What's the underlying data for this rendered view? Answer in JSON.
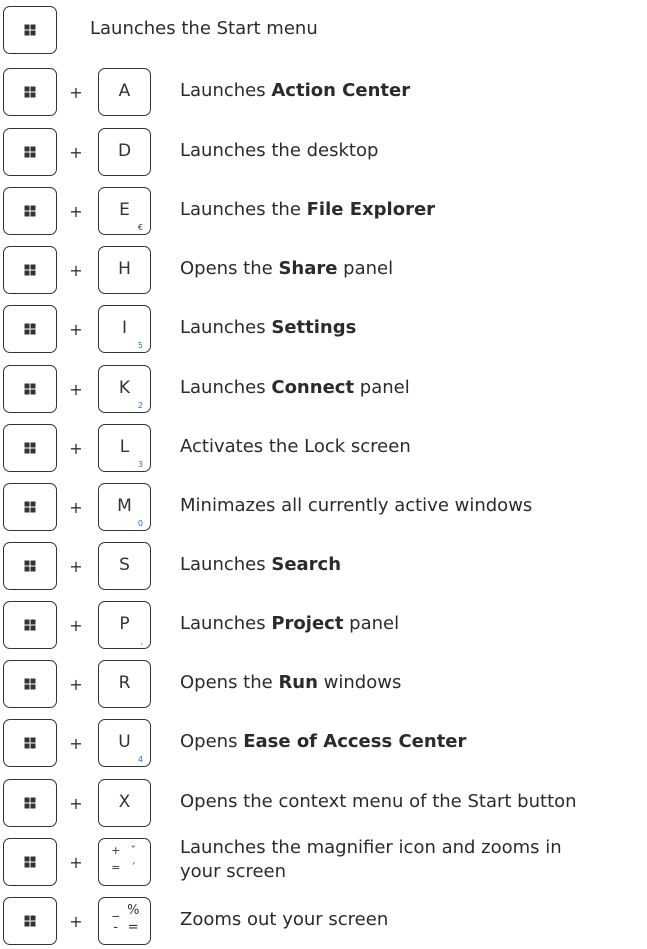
{
  "rows": [
    {
      "key": "",
      "sub": "",
      "pre": "Launches the Start menu",
      "bold": "",
      "post": ""
    },
    {
      "key": "A",
      "sub": "",
      "pre": "Launches ",
      "bold": "Action Center",
      "post": ""
    },
    {
      "key": "D",
      "sub": "",
      "pre": "Launches the desktop",
      "bold": "",
      "post": ""
    },
    {
      "key": "E",
      "sub": "€",
      "pre": "Launches the ",
      "bold": "File Explorer",
      "post": ""
    },
    {
      "key": "H",
      "sub": "",
      "pre": "Opens the ",
      "bold": "Share",
      "post": " panel"
    },
    {
      "key": "I",
      "sub": "5",
      "pre": "Launches ",
      "bold": "Settings",
      "post": ""
    },
    {
      "key": "K",
      "sub": "2",
      "pre": "Launches ",
      "bold": "Connect",
      "post": " panel"
    },
    {
      "key": "L",
      "sub": "3",
      "pre": "Activates the Lock screen",
      "bold": "",
      "post": ""
    },
    {
      "key": "M",
      "sub": "0",
      "pre": "Minimazes all currently active windows",
      "bold": "",
      "post": ""
    },
    {
      "key": "S",
      "sub": "",
      "pre": "Launches ",
      "bold": "Search",
      "post": ""
    },
    {
      "key": "P",
      "sub": ",",
      "pre": "Launches ",
      "bold": "Project",
      "post": " panel"
    },
    {
      "key": "R",
      "sub": "",
      "pre": "Opens the ",
      "bold": "Run",
      "post": " windows"
    },
    {
      "key": "U",
      "sub": "4",
      "pre": "Opens ",
      "bold": "Ease of Access Center",
      "post": ""
    },
    {
      "key": "X",
      "sub": "",
      "pre": "Opens the context menu of the Start button",
      "bold": "",
      "post": ""
    },
    {
      "key": "",
      "sub": "",
      "pre": "Launches the magnifier icon and zooms in",
      "bold": "",
      "post": "",
      "line2": "your screen",
      "symbols": [
        "+",
        "ˇ",
        "=",
        "´"
      ]
    },
    {
      "key": "",
      "sub": "",
      "pre": "Zooms out your screen",
      "bold": "",
      "post": "",
      "symbols": [
        "_",
        "%",
        "-",
        "="
      ]
    }
  ],
  "plus_label": "+",
  "win_icon": "windows-logo-icon"
}
